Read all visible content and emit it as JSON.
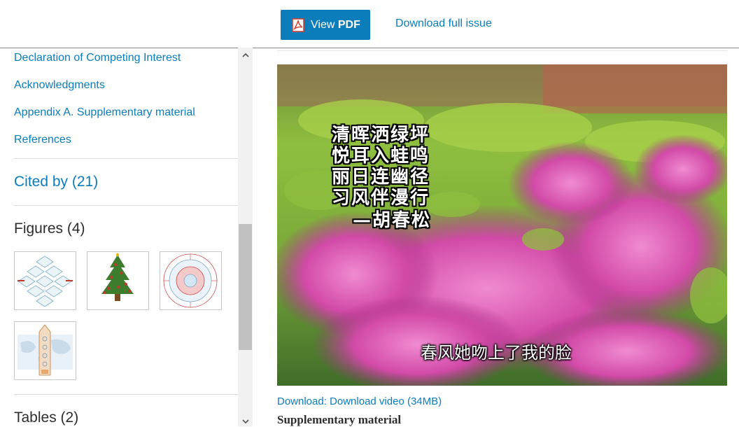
{
  "toolbar": {
    "view_pdf_prefix": "View",
    "view_pdf_bold": "PDF",
    "download_full_issue": "Download full issue"
  },
  "sidebar": {
    "toc_links": [
      "Declaration of Competing Interest",
      "Acknowledgments",
      "Appendix A. Supplementary material",
      "References"
    ],
    "cited_by": "Cited by (21)",
    "figures_heading": "Figures (4)",
    "tables_heading": "Tables (2)",
    "scroll_up_icon": "chevron-up-icon",
    "scroll_down_icon": "chevron-down-icon"
  },
  "main": {
    "video": {
      "poem": [
        "清晖洒绿坪",
        "悦耳入蛙鸣",
        "丽日连幽径",
        "习风伴漫行",
        "—胡春松"
      ],
      "subtitle": "春风她吻上了我的脸"
    },
    "download_video": "Download: Download video (34MB)",
    "supplementary_heading": "Supplementary material"
  },
  "colors": {
    "accent": "#0c7dbb",
    "text": "#2e2e2e"
  }
}
